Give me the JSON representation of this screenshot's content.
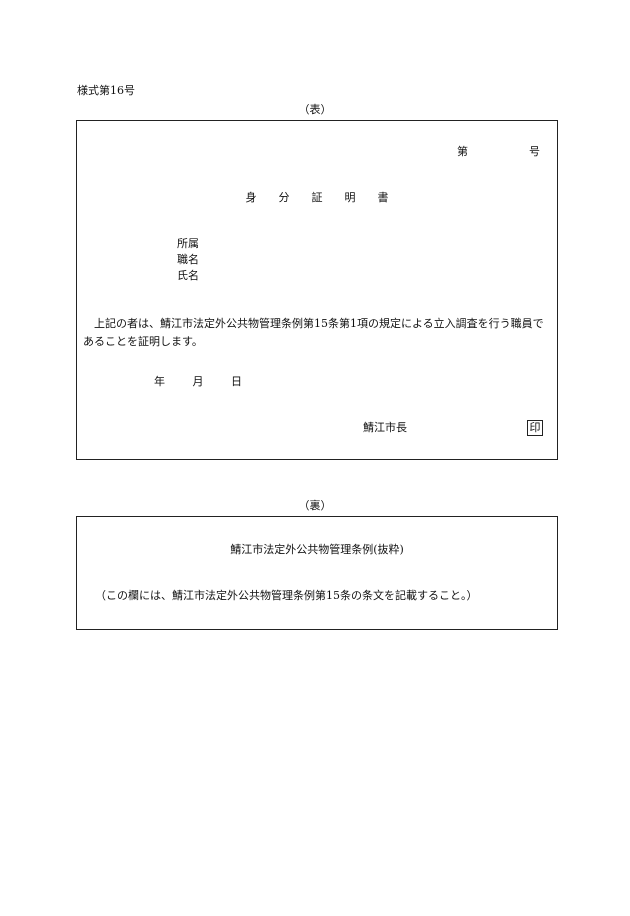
{
  "form_number": "様式第16号",
  "front": {
    "caption": "（表）",
    "number_dai": "第",
    "number_go": "号",
    "title": "身分証明書",
    "fields": [
      "所属",
      "職名",
      "氏名"
    ],
    "body": "上記の者は、鯖江市法定外公共物管理条例第15条第1項の規定による立入調査を行う職員であることを証明します。",
    "date": [
      "年",
      "月",
      "日"
    ],
    "issuer": "鯖江市長",
    "seal": "印"
  },
  "back": {
    "caption": "（裏）",
    "title": "鯖江市法定外公共物管理条例(抜粋)",
    "note": "（この欄には、鯖江市法定外公共物管理条例第15条の条文を記載すること。）"
  }
}
